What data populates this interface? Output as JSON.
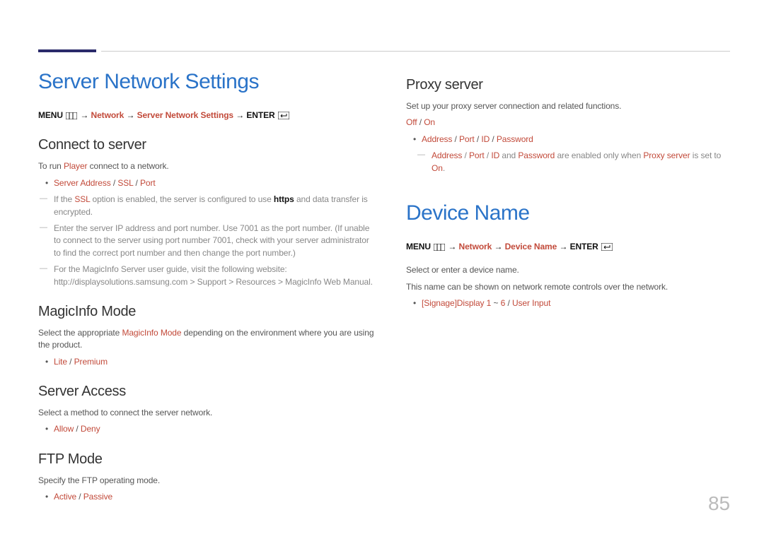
{
  "page_number": "85",
  "left": {
    "h1": "Server Network Settings",
    "path_menu": "MENU",
    "path_arrow": "→",
    "path_network": "Network",
    "path_sns": "Server Network Settings",
    "path_enter": "ENTER",
    "connect": {
      "h2": "Connect to server",
      "para_pre": "To run ",
      "para_player": "Player",
      "para_post": " connect to a network.",
      "bullet_sa": "Server Address",
      "bullet_ssl": "SSL",
      "bullet_port": "Port",
      "sep": " / ",
      "n1_pre": "If the ",
      "n1_ssl": "SSL",
      "n1_mid": " option is enabled, the server is configured to use ",
      "n1_https": "https",
      "n1_post": " and data transfer is encrypted.",
      "n2": "Enter the server IP address and port number. Use 7001 as the port number. (If unable to connect to the server using port number 7001, check with your server administrator to find the correct port number and then change the port number.)",
      "n3": "For the MagicInfo Server user guide, visit the following website: http://displaysolutions.samsung.com > Support > Resources > MagicInfo Web Manual."
    },
    "magic": {
      "h2": "MagicInfo Mode",
      "para_pre": "Select the appropriate ",
      "para_mode": "MagicInfo Mode",
      "para_post": " depending on the environment where you are using the product.",
      "lite": "Lite",
      "sep": " / ",
      "premium": "Premium"
    },
    "access": {
      "h2": "Server Access",
      "para": "Select a method to connect the server network.",
      "allow": "Allow",
      "sep": " / ",
      "deny": "Deny"
    },
    "ftp": {
      "h2": "FTP Mode",
      "para": "Specify the FTP operating mode.",
      "active": "Active",
      "sep": " / ",
      "passive": "Passive"
    }
  },
  "right": {
    "proxy": {
      "h2": "Proxy server",
      "para": "Set up your proxy server connection and related functions.",
      "off": "Off",
      "sep": " / ",
      "on": "On",
      "addr": "Address",
      "port": "Port",
      "id": "ID",
      "pw": "Password",
      "note_addr": "Address",
      "note_sep": " / ",
      "note_port": "Port",
      "note_id": "ID",
      "note_and": " and ",
      "note_pw": "Password",
      "note_mid": " are enabled only when ",
      "note_proxy": "Proxy server",
      "note_setto": " is set to ",
      "note_on": "On",
      "note_period": "."
    },
    "device": {
      "h1": "Device Name",
      "path_menu": "MENU",
      "path_arrow": "→",
      "path_network": "Network",
      "path_dn": "Device Name",
      "path_enter": "ENTER",
      "p1": "Select or enter a device name.",
      "p2": "This name can be shown on network remote controls over the network.",
      "signage": "[Signage]Display 1",
      "tilde": " ~ ",
      "six": "6",
      "sep": " / ",
      "user_input": "User Input"
    }
  }
}
